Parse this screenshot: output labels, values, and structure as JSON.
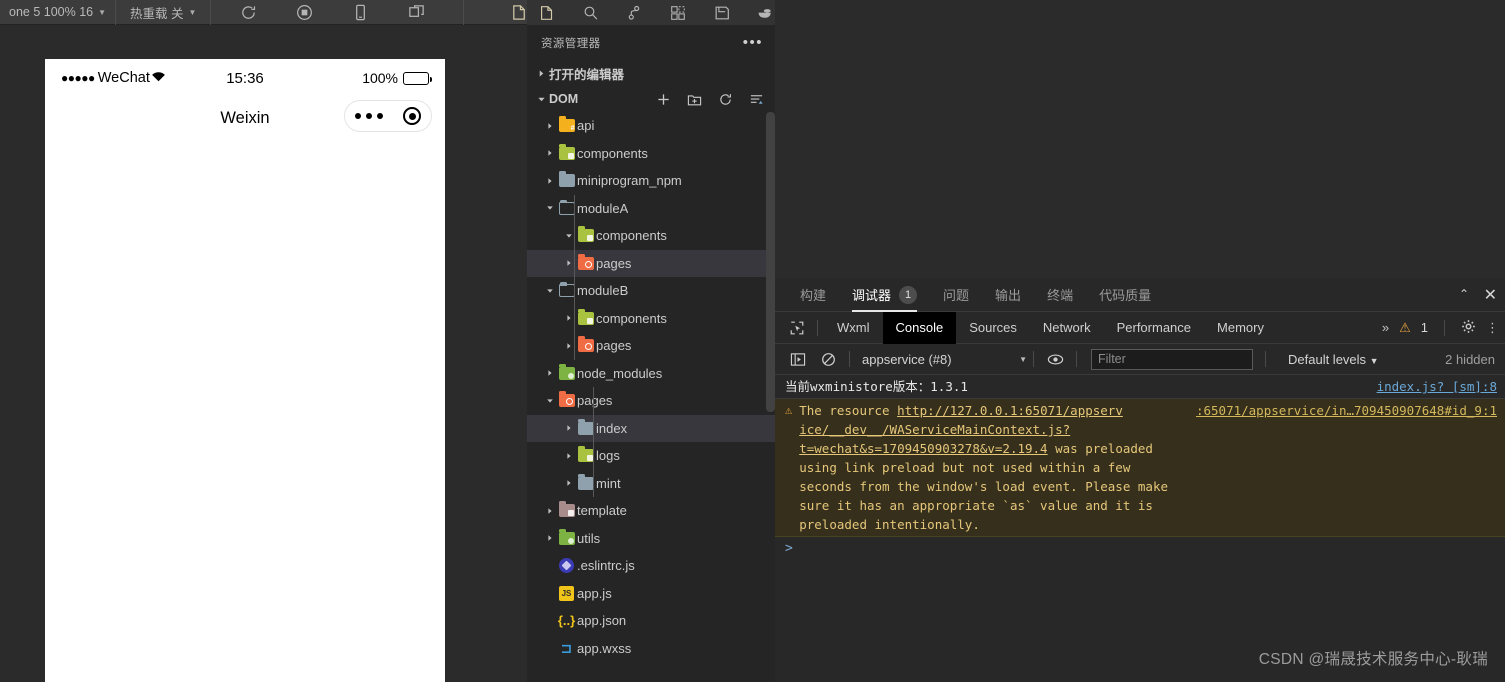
{
  "toolbar": {
    "device_label": "one 5 100% 16",
    "hotreload_label": "热重载 关",
    "icons": [
      "refresh-icon",
      "stop-record-icon",
      "preview-device-icon",
      "multi-window-icon"
    ],
    "activity_icons": [
      "explorer-icon",
      "search-icon",
      "source-control-icon",
      "extensions-icon",
      "save-icon",
      "docker-icon"
    ]
  },
  "simulator": {
    "status_dots": "●●●●●",
    "carrier": "WeChat",
    "time": "15:36",
    "battery_pct": "100%",
    "page_title": "Weixin",
    "capsule": {
      "more": "more-dots-icon",
      "close": "target-circle-icon"
    }
  },
  "explorer": {
    "title": "资源管理器",
    "more_label": "•••",
    "open_editors_label": "打开的编辑器",
    "workspace_label": "DOM",
    "actions": [
      "new-file-icon",
      "new-folder-icon",
      "refresh-icon",
      "collapse-all-icon"
    ],
    "tree": [
      {
        "label": "api",
        "icon": "folder-yellow",
        "depth": 1,
        "expanded": false,
        "type": "folder",
        "selected": false
      },
      {
        "label": "components",
        "icon": "folder-lime",
        "depth": 1,
        "expanded": false,
        "type": "folder",
        "selected": false
      },
      {
        "label": "miniprogram_npm",
        "icon": "folder-plain",
        "depth": 1,
        "expanded": false,
        "type": "folder",
        "selected": false
      },
      {
        "label": "moduleA",
        "icon": "folder-open",
        "depth": 1,
        "expanded": true,
        "type": "folder",
        "selected": false
      },
      {
        "label": "components",
        "icon": "folder-lime",
        "depth": 2,
        "expanded": true,
        "type": "folder",
        "selected": false
      },
      {
        "label": "pages",
        "icon": "folder-orange",
        "depth": 2,
        "expanded": false,
        "type": "folder",
        "selected": true
      },
      {
        "label": "moduleB",
        "icon": "folder-open",
        "depth": 1,
        "expanded": true,
        "type": "folder",
        "selected": false
      },
      {
        "label": "components",
        "icon": "folder-lime",
        "depth": 2,
        "expanded": false,
        "type": "folder",
        "selected": false
      },
      {
        "label": "pages",
        "icon": "folder-orange",
        "depth": 2,
        "expanded": false,
        "type": "folder",
        "selected": false
      },
      {
        "label": "node_modules",
        "icon": "folder-green",
        "depth": 1,
        "expanded": false,
        "type": "folder",
        "selected": false
      },
      {
        "label": "pages",
        "icon": "folder-orange",
        "depth": 1,
        "expanded": true,
        "type": "folder",
        "selected": false
      },
      {
        "label": "index",
        "icon": "folder-plain",
        "depth": 2,
        "expanded": false,
        "type": "folder",
        "selected": true
      },
      {
        "label": "logs",
        "icon": "folder-lime",
        "depth": 2,
        "expanded": false,
        "type": "folder",
        "selected": false
      },
      {
        "label": "mint",
        "icon": "folder-plain",
        "depth": 2,
        "expanded": false,
        "type": "folder",
        "selected": false
      },
      {
        "label": "template",
        "icon": "folder-mauve",
        "depth": 1,
        "expanded": false,
        "type": "folder",
        "selected": false
      },
      {
        "label": "utils",
        "icon": "folder-green",
        "depth": 1,
        "expanded": false,
        "type": "folder",
        "selected": false
      },
      {
        "label": ".eslintrc.js",
        "icon": "eslint-icon",
        "depth": 1,
        "expanded": false,
        "type": "file",
        "selected": false
      },
      {
        "label": "app.js",
        "icon": "js-icon",
        "depth": 1,
        "expanded": false,
        "type": "file",
        "selected": false
      },
      {
        "label": "app.json",
        "icon": "json-icon",
        "depth": 1,
        "expanded": false,
        "type": "file",
        "selected": false
      },
      {
        "label": "app.wxss",
        "icon": "wxss-icon",
        "depth": 1,
        "expanded": false,
        "type": "file",
        "selected": false
      }
    ]
  },
  "panel": {
    "tabs": [
      {
        "label": "构建",
        "active": false,
        "badge": ""
      },
      {
        "label": "调试器",
        "active": true,
        "badge": "1"
      },
      {
        "label": "问题",
        "active": false,
        "badge": ""
      },
      {
        "label": "输出",
        "active": false,
        "badge": ""
      },
      {
        "label": "终端",
        "active": false,
        "badge": ""
      },
      {
        "label": "代码质量",
        "active": false,
        "badge": ""
      }
    ],
    "collapse_icon": "chevron-up-icon",
    "close_icon": "close-icon"
  },
  "devtools": {
    "inspect_icon": "inspect-element-icon",
    "tabs": [
      {
        "label": "Wxml",
        "active": false
      },
      {
        "label": "Console",
        "active": true
      },
      {
        "label": "Sources",
        "active": false
      },
      {
        "label": "Network",
        "active": false
      },
      {
        "label": "Performance",
        "active": false
      },
      {
        "label": "Memory",
        "active": false
      }
    ],
    "overflow_label": "»",
    "warning_count": "1",
    "settings_icon": "gear-icon",
    "kebab_icon": "more-vertical-icon",
    "filterbar": {
      "sidebar_icon": "console-sidebar-icon",
      "clear_icon": "clear-console-icon",
      "context": "appservice (#8)",
      "eye_icon": "live-expression-icon",
      "filter_placeholder": "Filter",
      "filter_value": "",
      "levels": "Default levels",
      "hidden": "2 hidden"
    },
    "console": [
      {
        "type": "info",
        "text": "当前wxministore版本：1.3.1",
        "source": "index.js? [sm]:8"
      },
      {
        "type": "warning",
        "icon": "warning-triangle-icon",
        "segments": [
          {
            "t": "The resource ",
            "link": false
          },
          {
            "t": "http://127.0.0.1:65071/appserv",
            "link": true
          },
          {
            "t": " ",
            "link": false
          },
          {
            "t": "ice/__dev__/WAServiceMainContext.js?t=wechat&s=1709450903278&v=2.19.4",
            "link": true
          },
          {
            "t": " was preloaded using link preload but not used within a few seconds from the window's load event. Please make sure it has an appropriate `as` value and it is preloaded intentionally.",
            "link": false
          }
        ],
        "source": ":65071/appservice/in…709450907648#id_9:1"
      }
    ],
    "prompt": ">"
  },
  "annotation": {
    "arrow": "red-arrow-up-right",
    "arrow_color": "#ec1c24"
  },
  "watermark": "CSDN @瑞晟技术服务中心-耿瑞"
}
